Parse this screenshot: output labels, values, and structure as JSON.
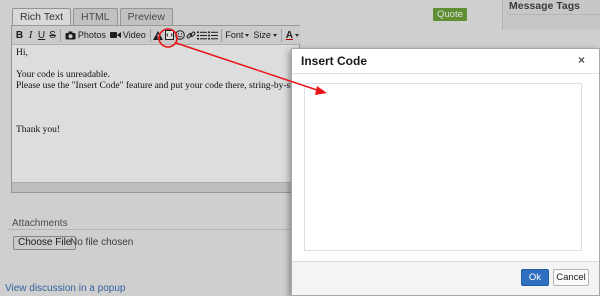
{
  "editor": {
    "tabs": [
      {
        "label": "Rich Text",
        "active": true
      },
      {
        "label": "HTML",
        "active": false
      },
      {
        "label": "Preview",
        "active": false
      }
    ],
    "quote_label": "Quote",
    "toolbar": {
      "bold": "B",
      "italic": "I",
      "underline": "U",
      "strike": "S",
      "photos": "Photos",
      "video": "Video",
      "font": "Font",
      "size": "Size",
      "color": "A"
    },
    "content": [
      "Hi,",
      "",
      "Your code is unreadable.",
      "Please use the \"Insert Code\" feature and put your code there, string-by-string.",
      "",
      "",
      "",
      "Thank you!"
    ]
  },
  "message_tags": {
    "title": "Message Tags"
  },
  "attachments": {
    "label": "Attachments",
    "choose_file": "Choose File",
    "no_file": "No file chosen"
  },
  "view_popup_link": "View discussion in a popup",
  "dialog": {
    "title": "Insert Code",
    "close": "×",
    "textarea_value": "",
    "ok_label": "Ok",
    "cancel_label": "Cancel"
  },
  "colors": {
    "annotation_red": "#e8141b",
    "ok_blue": "#2f6fc0",
    "quote_green": "#6da23b",
    "link_blue": "#3b6fb6"
  }
}
